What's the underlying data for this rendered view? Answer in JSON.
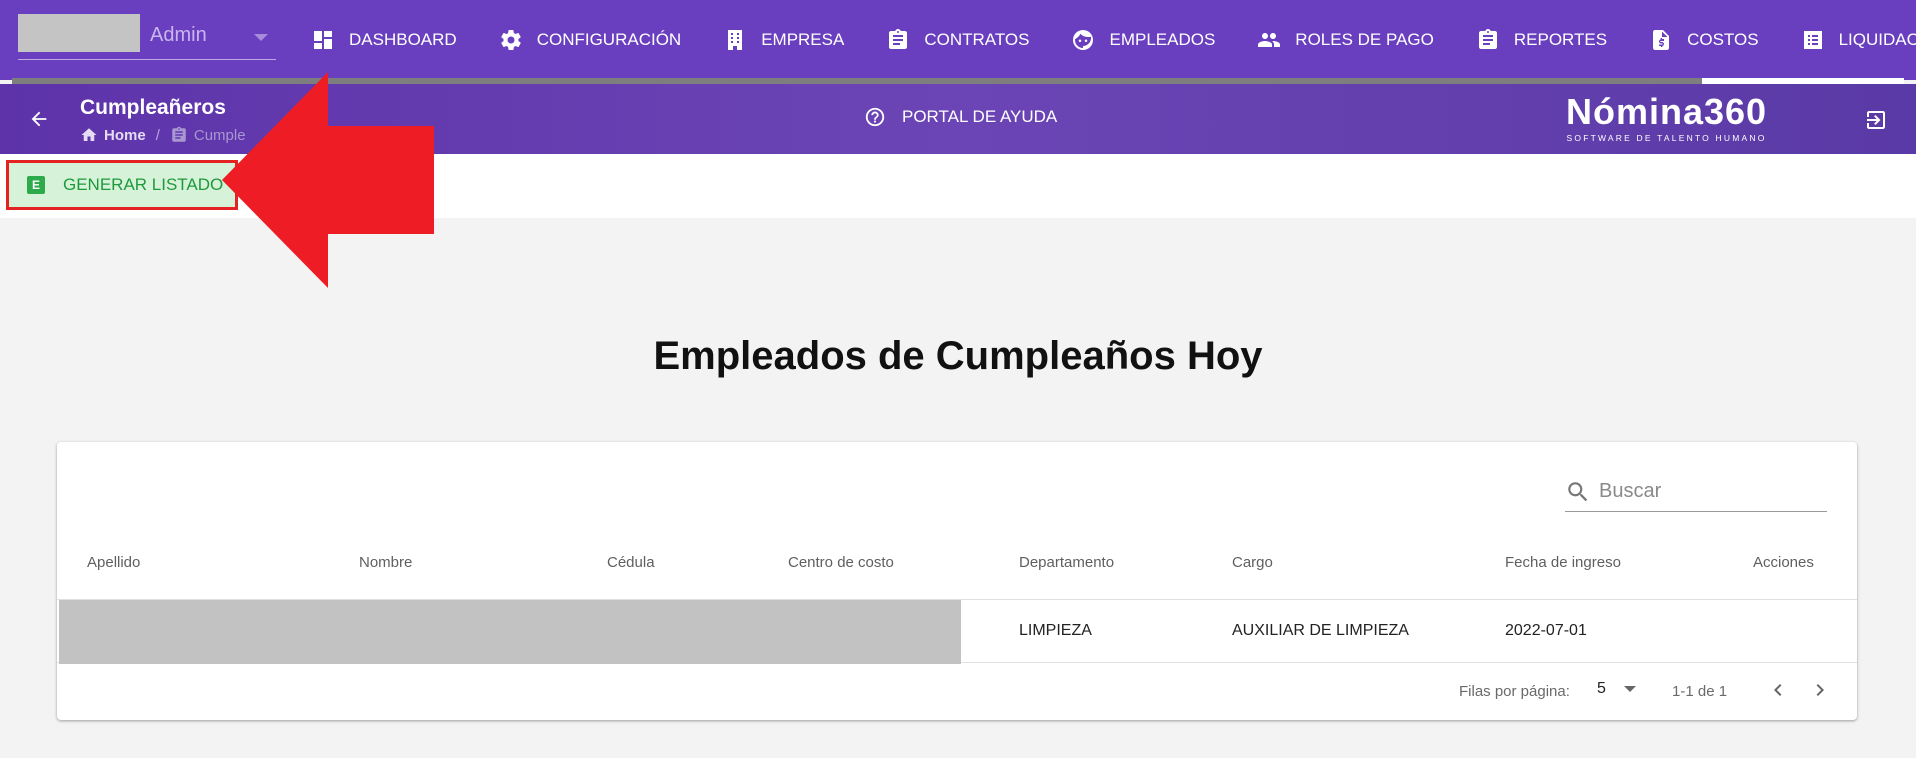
{
  "header": {
    "user_name": "Admin",
    "nav": [
      {
        "label": "DASHBOARD",
        "icon": "dashboard-icon"
      },
      {
        "label": "CONFIGURACIÓN",
        "icon": "gear-icon"
      },
      {
        "label": "EMPRESA",
        "icon": "building-icon"
      },
      {
        "label": "CONTRATOS",
        "icon": "clipboard-icon"
      },
      {
        "label": "EMPLEADOS",
        "icon": "face-icon"
      },
      {
        "label": "ROLES DE PAGO",
        "icon": "people-icon"
      },
      {
        "label": "REPORTES",
        "icon": "clipboard-icon"
      },
      {
        "label": "COSTOS",
        "icon": "dollar-file-icon"
      },
      {
        "label": "LIQUIDACIONES",
        "icon": "list-icon"
      }
    ]
  },
  "subheader": {
    "title": "Cumpleañeros",
    "breadcrumb_home": "Home",
    "breadcrumb_current": "Cumple",
    "help_label": "PORTAL DE AYUDA",
    "logo_main": "Nómina360",
    "logo_sub": "SOFTWARE DE TALENTO HUMANO"
  },
  "toolbar": {
    "generate_icon_letter": "E",
    "generate_label": "GENERAR LISTADO"
  },
  "main": {
    "heading": "Empleados de Cumpleaños Hoy",
    "search_placeholder": "Buscar",
    "columns": [
      "Apellido",
      "Nombre",
      "Cédula",
      "Centro de costo",
      "Departamento",
      "Cargo",
      "Fecha de ingreso",
      "Acciones"
    ],
    "rows": [
      {
        "departamento": "LIMPIEZA",
        "cargo": "AUXILIAR DE LIMPIEZA",
        "fecha_ingreso": "2022-07-01"
      }
    ],
    "pagination": {
      "rows_per_page_label": "Filas por página:",
      "rows_per_page": "5",
      "range": "1-1 de 1"
    }
  },
  "colors": {
    "nav_bg": "#6a3fbf",
    "generate_bg": "#d6f2d8",
    "generate_text": "#1e9a3d",
    "highlight_red": "#e32222"
  }
}
